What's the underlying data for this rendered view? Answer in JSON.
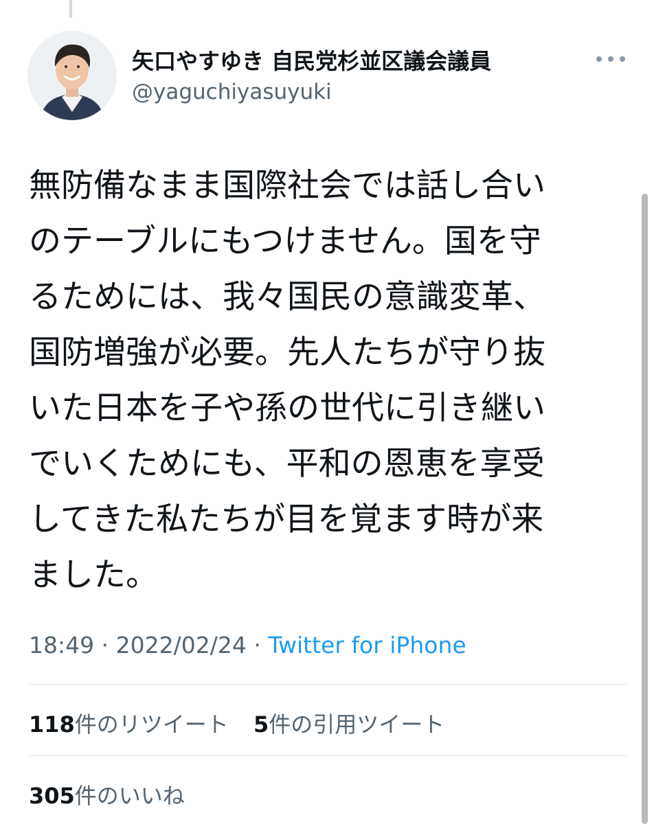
{
  "author": {
    "name": "矢口やすゆき 自民党杉並区議会議員",
    "handle": "@yaguchiyasuyuki"
  },
  "tweet": {
    "lines": [
      "無防備なまま国際社会では話し合い",
      "のテーブルにもつけません。国を守",
      "るためには、我々国民の意識変革、",
      "国防増強が必要。先人たちが守り抜",
      "いた日本を子や孫の世代に引き継い",
      "でいくためにも、平和の恩恵を享受",
      "してきた私たちが目を覚ます時が来",
      "ました。"
    ],
    "time": "18:49",
    "separator": "·",
    "date": "2022/02/24",
    "source": "Twitter for iPhone"
  },
  "stats": {
    "retweets_count": "118",
    "retweets_label": "件のリツイート",
    "quotes_count": "5",
    "quotes_label": "件の引用ツイート",
    "likes_count": "305",
    "likes_label": "件のいいね"
  },
  "icons": {
    "more": "more-horizontal-icon",
    "avatar": "profile-photo"
  },
  "colors": {
    "text_primary": "#0f1419",
    "text_secondary": "#536471",
    "link": "#1d9bf0",
    "divider": "#e1e6ea"
  }
}
